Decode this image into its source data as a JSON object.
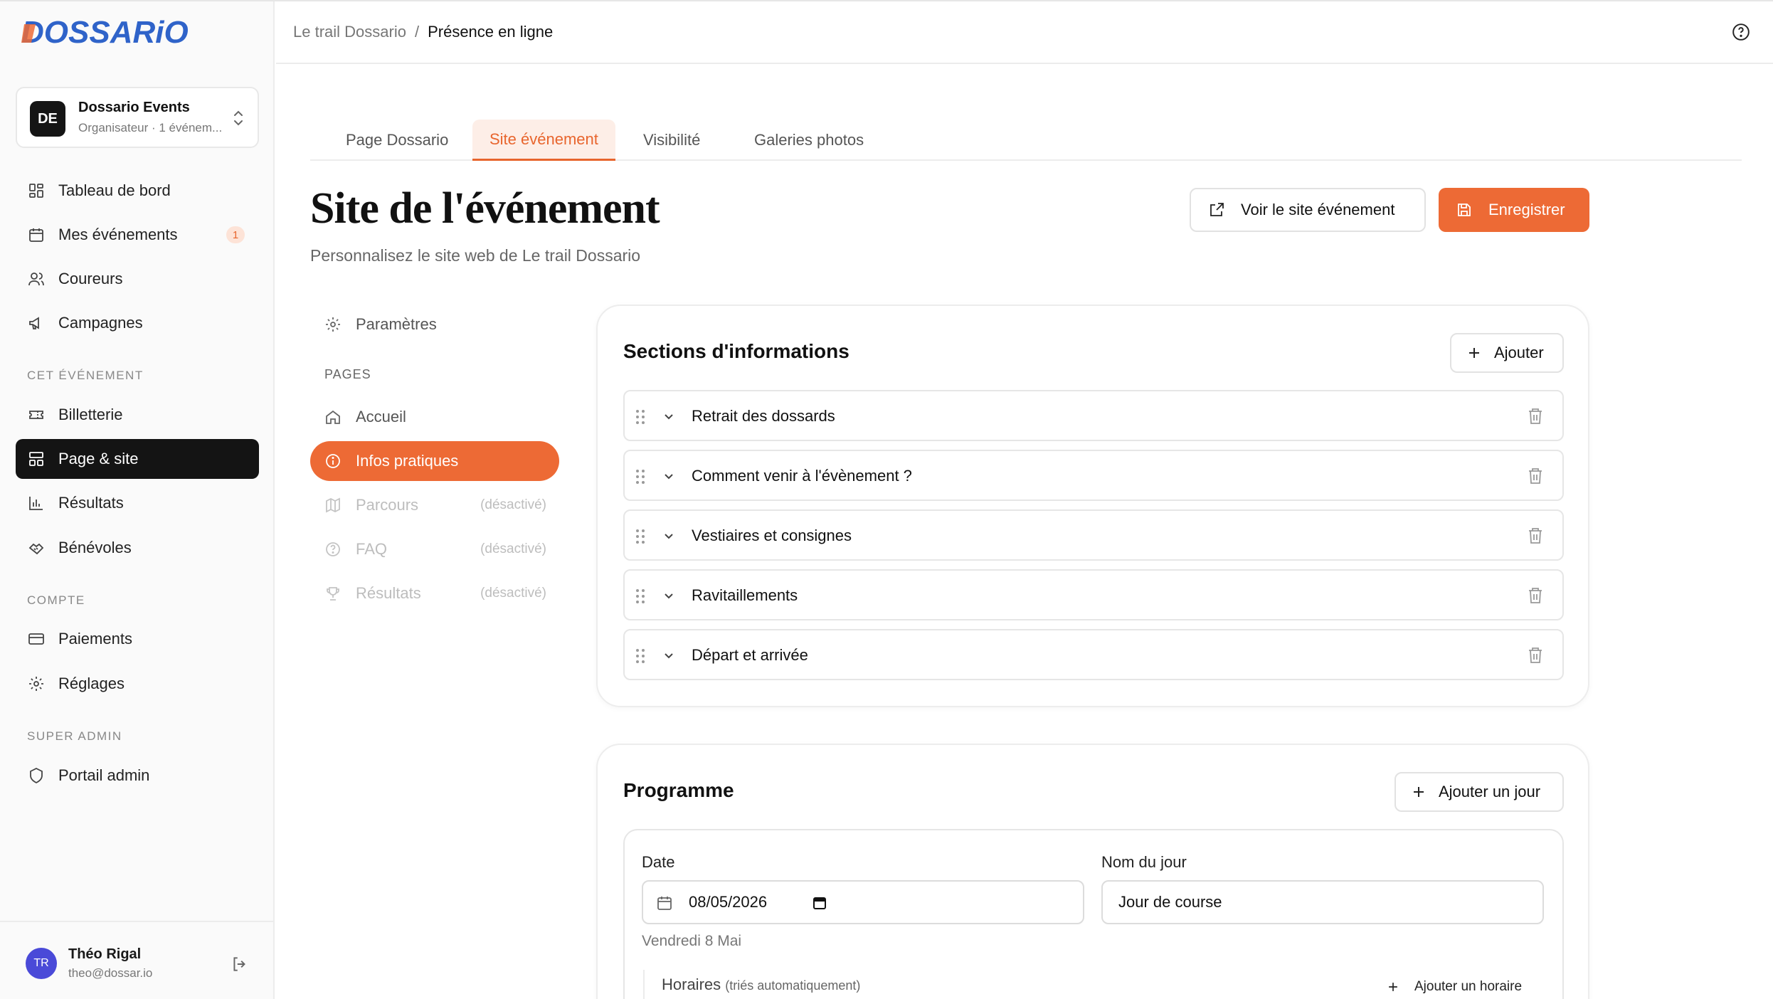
{
  "app": {
    "logo_text": "DOSSARiO",
    "brand_color": "#ed6a35"
  },
  "org": {
    "initials": "DE",
    "name": "Dossario Events",
    "subtitle": "Organisateur · 1 événem..."
  },
  "nav": {
    "main": [
      {
        "label": "Tableau de bord",
        "icon": "dashboard-icon"
      },
      {
        "label": "Mes événements",
        "icon": "calendar-icon",
        "badge": "1"
      },
      {
        "label": "Coureurs",
        "icon": "users-icon"
      },
      {
        "label": "Campagnes",
        "icon": "megaphone-icon"
      }
    ],
    "event_section_label": "CET ÉVÉNEMENT",
    "event": [
      {
        "label": "Billetterie",
        "icon": "ticket-icon"
      },
      {
        "label": "Page & site",
        "icon": "layout-icon",
        "active": true
      },
      {
        "label": "Résultats",
        "icon": "bar-chart-icon"
      },
      {
        "label": "Bénévoles",
        "icon": "handshake-icon"
      }
    ],
    "account_section_label": "COMPTE",
    "account": [
      {
        "label": "Paiements",
        "icon": "credit-card-icon"
      },
      {
        "label": "Réglages",
        "icon": "gear-icon"
      }
    ],
    "admin_section_label": "SUPER ADMIN",
    "admin": [
      {
        "label": "Portail admin",
        "icon": "shield-icon"
      }
    ]
  },
  "user": {
    "initials": "TR",
    "name": "Théo Rigal",
    "email": "theo@dossar.io"
  },
  "breadcrumb": {
    "parent": "Le trail Dossario",
    "separator": "/",
    "current": "Présence en ligne"
  },
  "tabs": [
    "Page Dossario",
    "Site événement",
    "Visibilité",
    "Galeries photos"
  ],
  "active_tab": "Site événement",
  "page": {
    "title": "Site de l'événement",
    "subtitle": "Personnalisez le site web de Le trail Dossario",
    "view_button": "Voir le site événement",
    "save_button": "Enregistrer"
  },
  "subnav": {
    "settings": "Paramètres",
    "pages_label": "PAGES",
    "pages": [
      {
        "label": "Accueil",
        "icon": "home-icon",
        "state": "normal"
      },
      {
        "label": "Infos pratiques",
        "icon": "info-icon",
        "state": "active"
      },
      {
        "label": "Parcours",
        "icon": "map-icon",
        "state": "disabled",
        "note": "(désactivé)"
      },
      {
        "label": "FAQ",
        "icon": "question-icon",
        "state": "disabled",
        "note": "(désactivé)"
      },
      {
        "label": "Résultats",
        "icon": "trophy-icon",
        "state": "disabled",
        "note": "(désactivé)"
      }
    ]
  },
  "info_sections": {
    "title": "Sections d'informations",
    "add_button": "Ajouter",
    "items": [
      "Retrait des dossards",
      "Comment venir à l'évènement ?",
      "Vestiaires et consignes",
      "Ravitaillements",
      "Départ et arrivée"
    ]
  },
  "programme": {
    "title": "Programme",
    "add_day_button": "Ajouter un jour",
    "date_label": "Date",
    "date_value": "08/05/2026",
    "date_hint": "Vendredi 8 Mai",
    "day_name_label": "Nom du jour",
    "day_name_value": "Jour de course",
    "schedules_label": "Horaires",
    "schedules_note": "(triés automatiquement)",
    "add_schedule_button": "Ajouter un horaire"
  }
}
